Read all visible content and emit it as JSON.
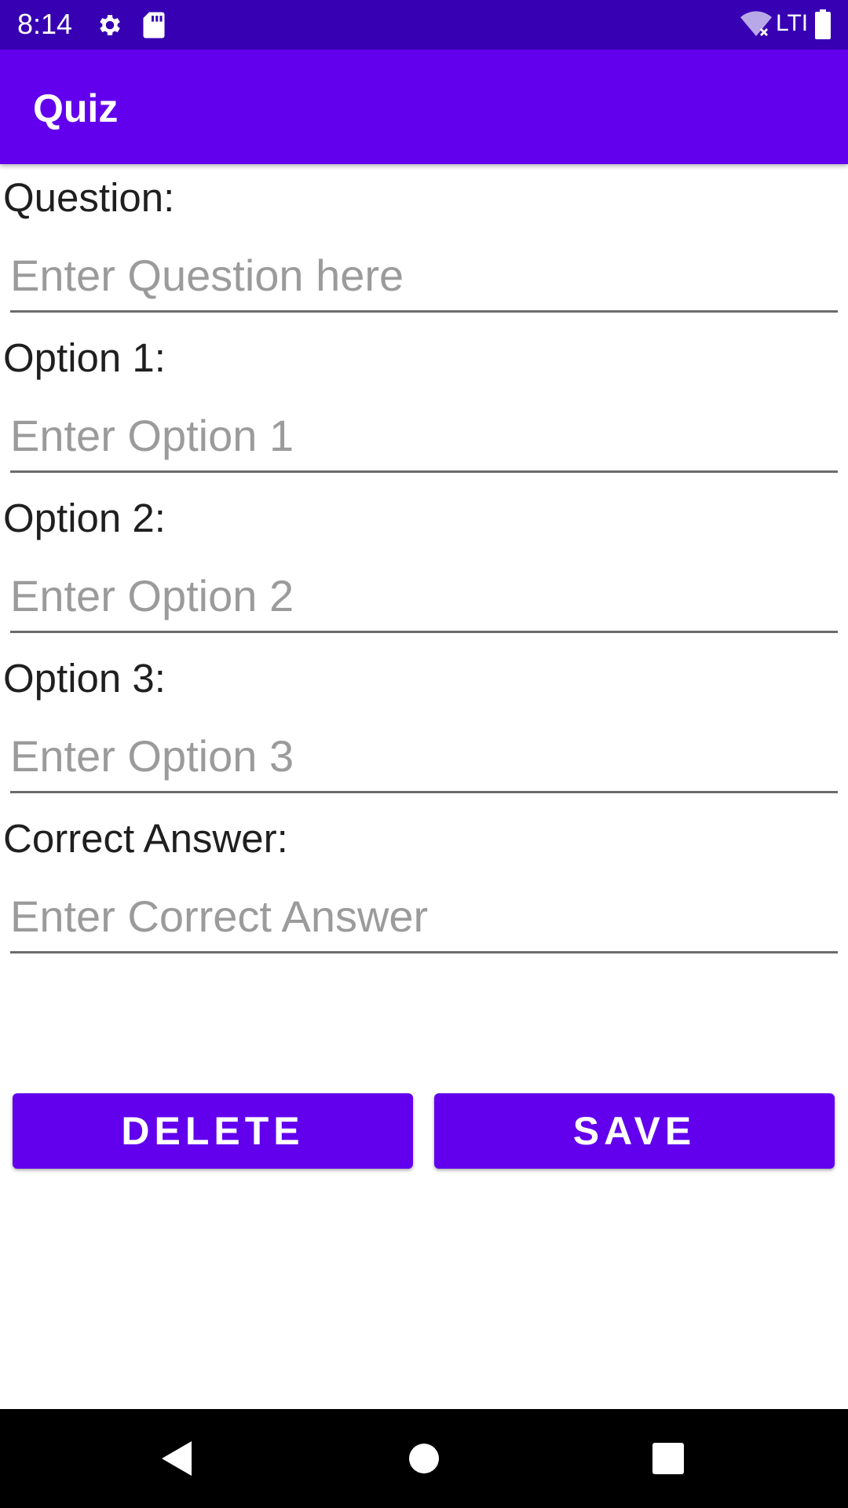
{
  "status_bar": {
    "time": "8:14",
    "network_label": "LTI",
    "icons": [
      "gear-icon",
      "sd-card-icon",
      "wifi-icon",
      "battery-icon"
    ]
  },
  "app_bar": {
    "title": "Quiz"
  },
  "form": {
    "question": {
      "label": "Question:",
      "placeholder": "Enter Question here",
      "value": ""
    },
    "option1": {
      "label": "Option 1:",
      "placeholder": "Enter Option 1",
      "value": ""
    },
    "option2": {
      "label": "Option 2:",
      "placeholder": "Enter Option 2",
      "value": ""
    },
    "option3": {
      "label": "Option 3:",
      "placeholder": "Enter Option 3",
      "value": ""
    },
    "correct_answer": {
      "label": "Correct Answer:",
      "placeholder": "Enter Correct Answer",
      "value": ""
    }
  },
  "buttons": {
    "delete_label": "DELETE",
    "save_label": "SAVE"
  },
  "nav_bar": {
    "icons": [
      "back-icon",
      "home-icon",
      "recents-icon"
    ]
  },
  "colors": {
    "status_bar": "#3700b3",
    "primary": "#6200ee",
    "on_primary": "#ffffff",
    "hint_text": "#9b9b9b",
    "nav_bar": "#000000"
  }
}
